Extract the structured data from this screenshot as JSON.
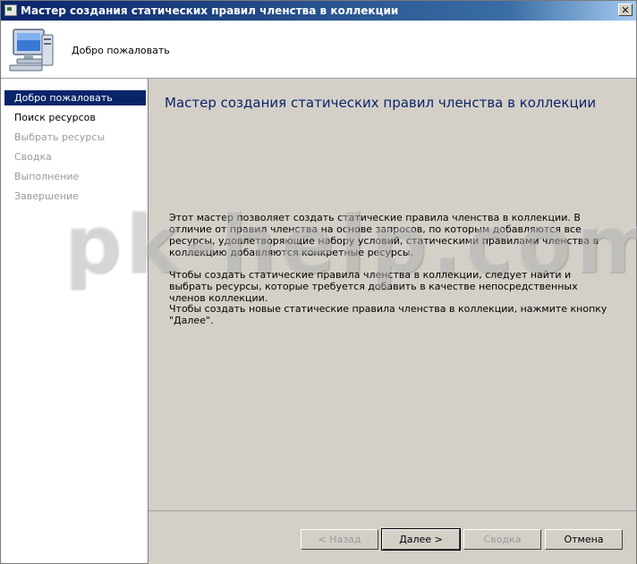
{
  "window": {
    "title": "Мастер создания статических правил членства в коллекции",
    "close_glyph": "✕"
  },
  "header": {
    "icon": "computer-icon",
    "text": "Добро пожаловать"
  },
  "sidebar": {
    "items": [
      {
        "label": "Добро пожаловать",
        "state": "active"
      },
      {
        "label": "Поиск ресурсов",
        "state": "current"
      },
      {
        "label": "Выбрать ресурсы",
        "state": "disabled"
      },
      {
        "label": "Сводка",
        "state": "disabled"
      },
      {
        "label": "Выполнение",
        "state": "disabled"
      },
      {
        "label": "Завершение",
        "state": "disabled"
      }
    ]
  },
  "content": {
    "title": "Мастер создания статических правил членства в коллекции",
    "paragraphs": [
      "Этот мастер позволяет создать статические правила членства в коллекции. В отличие от правил членства на основе запросов, по которым добавляются все ресурсы, удовлетворяющие набору условий, статическими правилами членства в коллекцию добавляются конкретные ресурсы.",
      "Чтобы создать статические правила членства в коллекции, следует найти и выбрать ресурсы, которые требуется добавить в качестве непосредственных членов коллекции.",
      "Чтобы создать новые статические правила членства в коллекции, нажмите кнопку \"Далее\"."
    ]
  },
  "buttons": {
    "back": "< Назад",
    "next": "Далее >",
    "summary": "Сводка",
    "cancel": "Отмена"
  },
  "watermark": "pk-help.com",
  "colors": {
    "titlebar": "#0a246a",
    "selection": "#0a246a",
    "title_text": "#0a246a",
    "disabled_text": "#9a9a9a"
  }
}
